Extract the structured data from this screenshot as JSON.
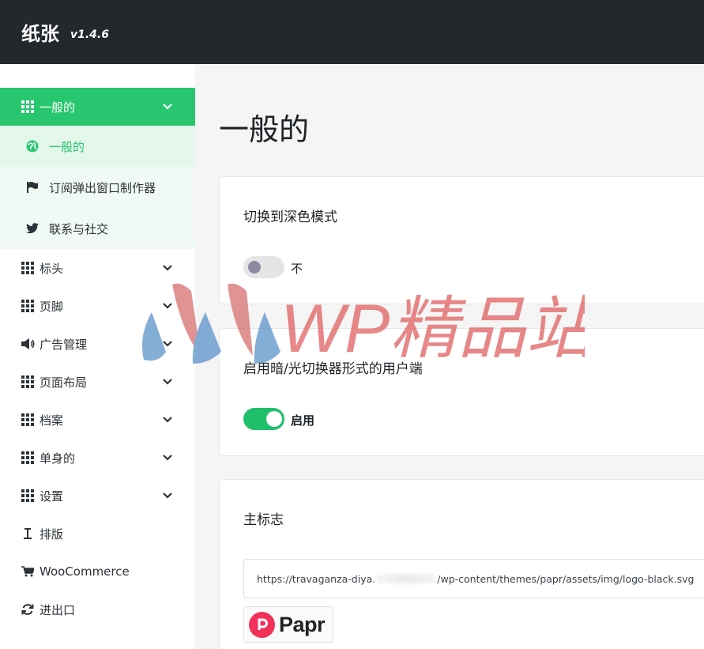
{
  "header": {
    "brand": "纸张",
    "version": "v1.4.6"
  },
  "sidebar": {
    "active_group": {
      "label": "一般的",
      "icon": "grid-icon"
    },
    "sub_items": [
      {
        "label": "一般的",
        "icon": "globe-icon",
        "current": true
      },
      {
        "label": "订阅弹出窗口制作器",
        "icon": "flag-icon"
      },
      {
        "label": "联系与社交",
        "icon": "twitter-icon"
      }
    ],
    "items": [
      {
        "label": "标头",
        "icon": "grid-icon",
        "expandable": true
      },
      {
        "label": "页脚",
        "icon": "grid-icon",
        "expandable": true
      },
      {
        "label": "广告管理",
        "icon": "megaphone-icon",
        "expandable": true
      },
      {
        "label": "页面布局",
        "icon": "grid-icon",
        "expandable": true
      },
      {
        "label": "档案",
        "icon": "grid-icon",
        "expandable": true
      },
      {
        "label": "单身的",
        "icon": "grid-icon",
        "expandable": true
      },
      {
        "label": "设置",
        "icon": "grid-icon",
        "expandable": true
      },
      {
        "label": "排版",
        "icon": "text-height-icon",
        "expandable": false
      },
      {
        "label": "WooCommerce",
        "icon": "cart-icon",
        "expandable": false
      },
      {
        "label": "进出口",
        "icon": "sync-icon",
        "expandable": false
      }
    ]
  },
  "main": {
    "page_title": "一般的",
    "dark_mode": {
      "title": "切换到深色模式",
      "enabled": false,
      "state_label": "不"
    },
    "switcher": {
      "title": "启用暗/光切换器形式的用户端",
      "enabled": true,
      "state_label": "启用"
    },
    "logo": {
      "title": "主标志",
      "url_start": "https://travaganza-diya.",
      "url_end": "/wp-content/themes/papr/assets/img/logo-black.svg",
      "preview_text": "Papr"
    }
  },
  "watermark": {
    "text": "WP精品站"
  },
  "colors": {
    "accent": "#28c76f",
    "topbar": "#23282d",
    "toggle_on": "#1fbf6b",
    "logo_red": "#f0325a",
    "watermark_red": "#e06060",
    "watermark_blue": "#4a8fc4"
  }
}
